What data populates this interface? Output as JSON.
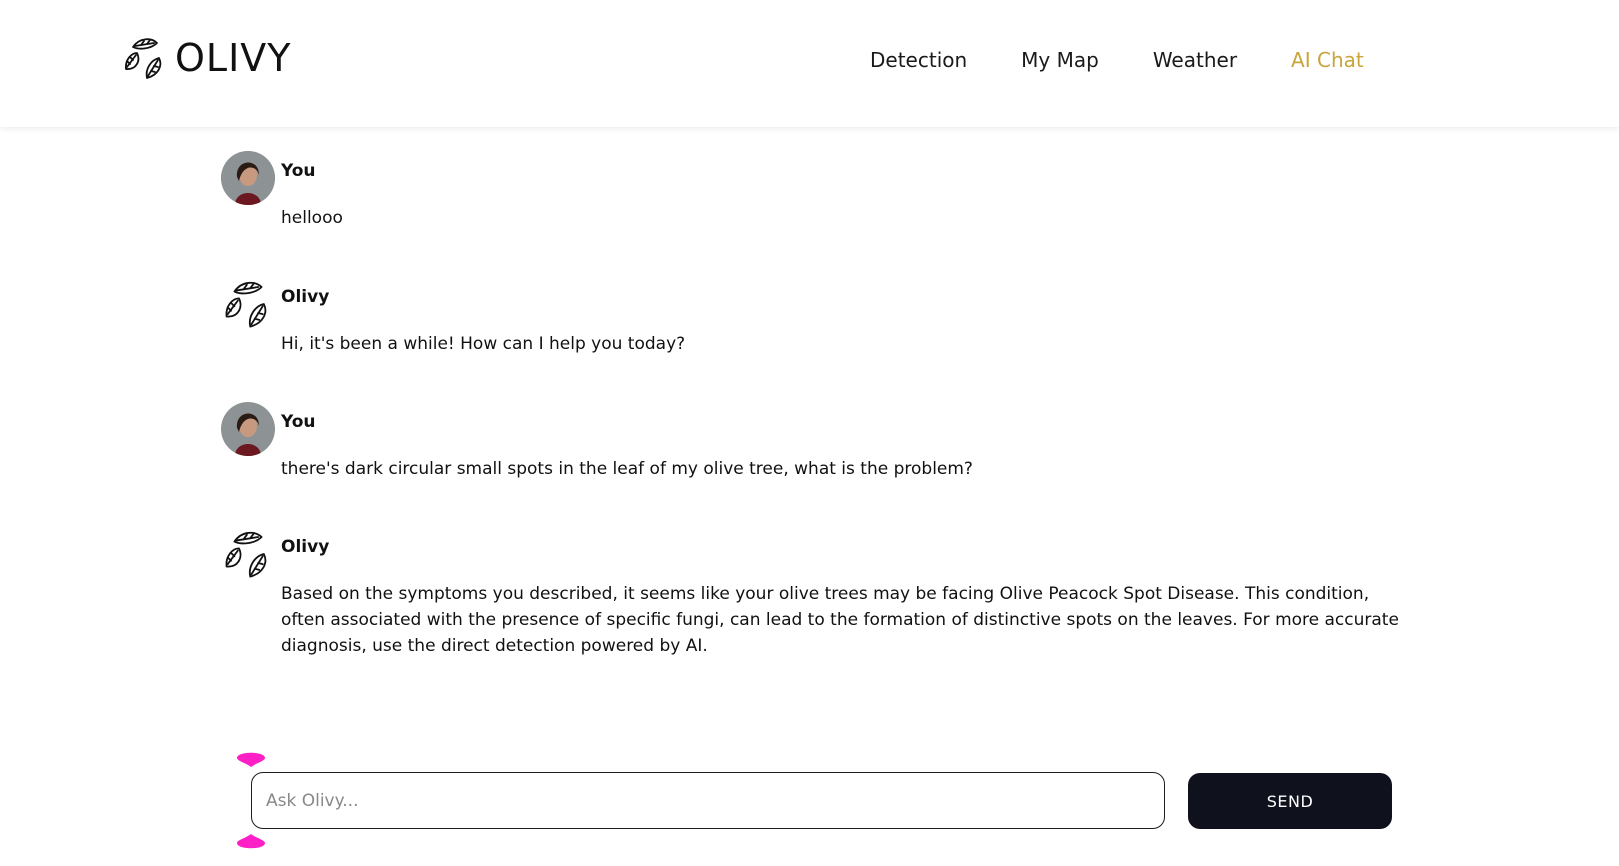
{
  "brand": {
    "name": "OLIVY",
    "logo_icon": "olive-leaves-icon"
  },
  "nav": {
    "items": [
      {
        "label": "Detection",
        "active": false
      },
      {
        "label": "My Map",
        "active": false
      },
      {
        "label": "Weather",
        "active": false
      },
      {
        "label": "AI Chat",
        "active": true
      }
    ],
    "active_color": "#c9a43a"
  },
  "messages": [
    {
      "sender": "You",
      "text": "hellooo",
      "avatar": "user-avatar"
    },
    {
      "sender": "Olivy",
      "text": "Hi, it's been a while! How can I help you today?",
      "avatar": "olivy-logo-icon"
    },
    {
      "sender": "You",
      "text": "there's dark circular small spots in the leaf of my olive tree, what is the problem?",
      "avatar": "user-avatar"
    },
    {
      "sender": "Olivy",
      "text": "Based on the symptoms you described, it seems like your olive trees may be facing Olive Peacock Spot Disease. This condition, often associated with the presence of specific fungi, can lead to the formation of distinctive spots on the leaves. For more accurate diagnosis, use the direct detection powered by AI.",
      "avatar": "olivy-logo-icon"
    }
  ],
  "composer": {
    "placeholder": "Ask Olivy...",
    "value": "",
    "send_label": "SEND",
    "send_color": "#0f111c",
    "marker_color": "#ff1fc7"
  }
}
